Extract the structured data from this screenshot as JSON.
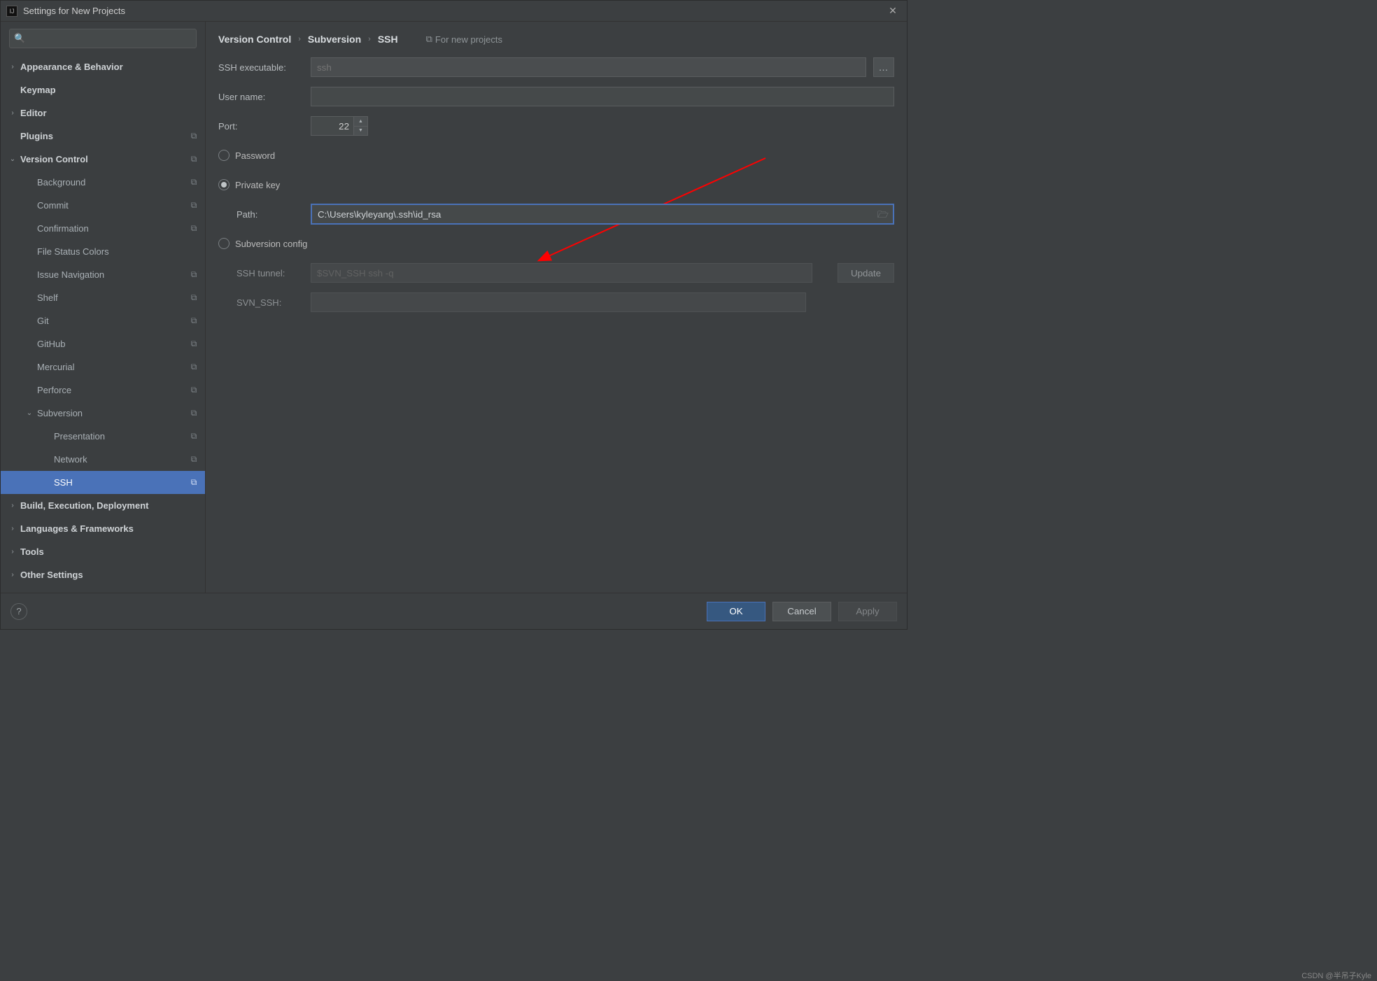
{
  "window": {
    "title": "Settings for New Projects"
  },
  "sidebar": {
    "search_placeholder": "",
    "items": [
      {
        "label": "Appearance & Behavior",
        "chev": "›",
        "bold": true,
        "depth": 0,
        "copy": false
      },
      {
        "label": "Keymap",
        "chev": "",
        "bold": true,
        "depth": 0,
        "copy": false
      },
      {
        "label": "Editor",
        "chev": "›",
        "bold": true,
        "depth": 0,
        "copy": false
      },
      {
        "label": "Plugins",
        "chev": "",
        "bold": true,
        "depth": 0,
        "copy": true
      },
      {
        "label": "Version Control",
        "chev": "⌄",
        "bold": true,
        "depth": 0,
        "copy": true
      },
      {
        "label": "Background",
        "chev": "",
        "bold": false,
        "depth": 1,
        "copy": true
      },
      {
        "label": "Commit",
        "chev": "",
        "bold": false,
        "depth": 1,
        "copy": true
      },
      {
        "label": "Confirmation",
        "chev": "",
        "bold": false,
        "depth": 1,
        "copy": true
      },
      {
        "label": "File Status Colors",
        "chev": "",
        "bold": false,
        "depth": 1,
        "copy": false
      },
      {
        "label": "Issue Navigation",
        "chev": "",
        "bold": false,
        "depth": 1,
        "copy": true
      },
      {
        "label": "Shelf",
        "chev": "",
        "bold": false,
        "depth": 1,
        "copy": true
      },
      {
        "label": "Git",
        "chev": "",
        "bold": false,
        "depth": 1,
        "copy": true
      },
      {
        "label": "GitHub",
        "chev": "",
        "bold": false,
        "depth": 1,
        "copy": true
      },
      {
        "label": "Mercurial",
        "chev": "",
        "bold": false,
        "depth": 1,
        "copy": true
      },
      {
        "label": "Perforce",
        "chev": "",
        "bold": false,
        "depth": 1,
        "copy": true
      },
      {
        "label": "Subversion",
        "chev": "⌄",
        "bold": false,
        "depth": 1,
        "copy": true
      },
      {
        "label": "Presentation",
        "chev": "",
        "bold": false,
        "depth": 2,
        "copy": true
      },
      {
        "label": "Network",
        "chev": "",
        "bold": false,
        "depth": 2,
        "copy": true
      },
      {
        "label": "SSH",
        "chev": "",
        "bold": false,
        "depth": 2,
        "copy": true,
        "selected": true
      },
      {
        "label": "Build, Execution, Deployment",
        "chev": "›",
        "bold": true,
        "depth": 0,
        "copy": false
      },
      {
        "label": "Languages & Frameworks",
        "chev": "›",
        "bold": true,
        "depth": 0,
        "copy": false
      },
      {
        "label": "Tools",
        "chev": "›",
        "bold": true,
        "depth": 0,
        "copy": false
      },
      {
        "label": "Other Settings",
        "chev": "›",
        "bold": true,
        "depth": 0,
        "copy": false
      }
    ]
  },
  "breadcrumb": {
    "c1": "Version Control",
    "c2": "Subversion",
    "c3": "SSH",
    "hint": "For new projects"
  },
  "form": {
    "ssh_executable_label": "SSH executable:",
    "ssh_executable_placeholder": "ssh",
    "ssh_executable_value": "",
    "username_label": "User name:",
    "username_value": "",
    "port_label": "Port:",
    "port_value": "22",
    "radio_password": "Password",
    "radio_private_key": "Private key",
    "radio_subversion_config": "Subversion config",
    "selected_radio": "private_key",
    "path_label": "Path:",
    "path_value": "C:\\Users\\kyleyang\\.ssh\\id_rsa",
    "ssh_tunnel_label": "SSH tunnel:",
    "ssh_tunnel_placeholder": "$SVN_SSH ssh -q",
    "svn_ssh_label": "SVN_SSH:",
    "svn_ssh_value": "",
    "update_btn": "Update"
  },
  "footer": {
    "ok": "OK",
    "cancel": "Cancel",
    "apply": "Apply"
  },
  "watermark": "CSDN @半吊子Kyle"
}
